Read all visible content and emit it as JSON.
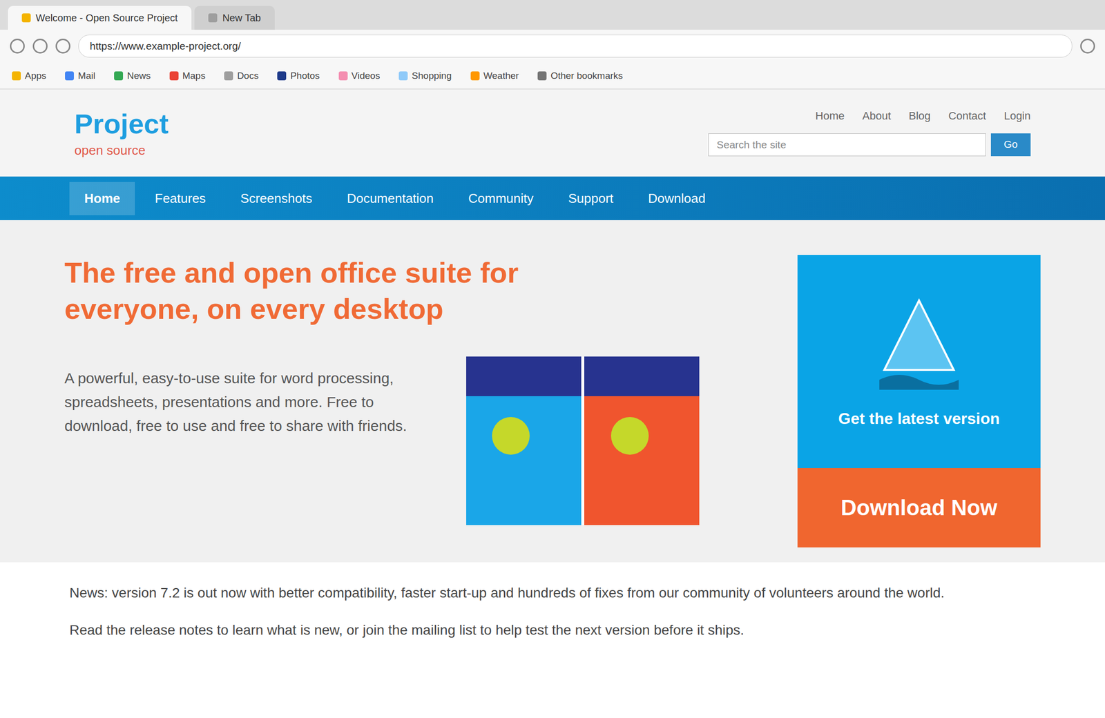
{
  "window": {
    "title": "Welcome - Open Source Project"
  },
  "browser": {
    "tabs": [
      {
        "label": "Welcome - Open Source Project",
        "selected": true
      },
      {
        "label": "New Tab",
        "selected": false
      }
    ],
    "url": "https://www.example-project.org/",
    "bookmarks": [
      "Apps",
      "Mail",
      "News",
      "Maps",
      "Docs",
      "Photos",
      "Videos",
      "Shopping",
      "Weather",
      "Other bookmarks"
    ]
  },
  "header": {
    "logo_main": "Project",
    "logo_sub": "open source",
    "top_links": [
      "Home",
      "About",
      "Blog",
      "Contact",
      "Login"
    ],
    "search": {
      "placeholder": "Search the site",
      "button": "Go"
    }
  },
  "navbar": {
    "items": [
      {
        "label": "Home",
        "selected": true
      },
      {
        "label": "Features",
        "selected": false
      },
      {
        "label": "Screenshots",
        "selected": false
      },
      {
        "label": "Documentation",
        "selected": false
      },
      {
        "label": "Community",
        "selected": false
      },
      {
        "label": "Support",
        "selected": false
      },
      {
        "label": "Download",
        "selected": false
      }
    ]
  },
  "hero": {
    "heading": "The free and open office suite for everyone, on every desktop",
    "paragraph": "A powerful, easy-to-use suite for word processing, spreadsheets, presentations and more. Free to download, free to use and free to share with friends."
  },
  "card": {
    "title": "Get the latest version",
    "button": "Download Now"
  },
  "footer": {
    "paragraphs": [
      "News: version 7.2 is out now with better compatibility, faster start-up and hundreds of fixes from our community of volunteers around the world.",
      "Read the release notes to learn what is new, or join the mailing list to help test the next version before it ships."
    ]
  }
}
